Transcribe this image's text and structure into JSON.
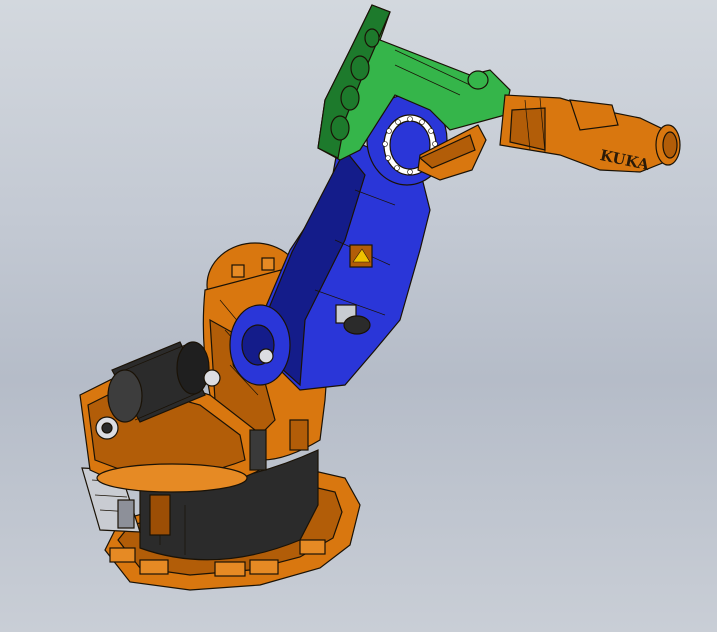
{
  "scene": {
    "brand_label": "KUKA",
    "colors": {
      "background_top": "#d3d8de",
      "background_bottom": "#b5bcc8",
      "orange": "#d9770f",
      "orange_dark": "#9c4e05",
      "blue": "#2a36d8",
      "blue_dark": "#141c8a",
      "green": "#35b54a",
      "green_dark": "#1d7a2c",
      "motor_black": "#2b2b2b",
      "plate_silver": "#c9ccd2"
    }
  }
}
